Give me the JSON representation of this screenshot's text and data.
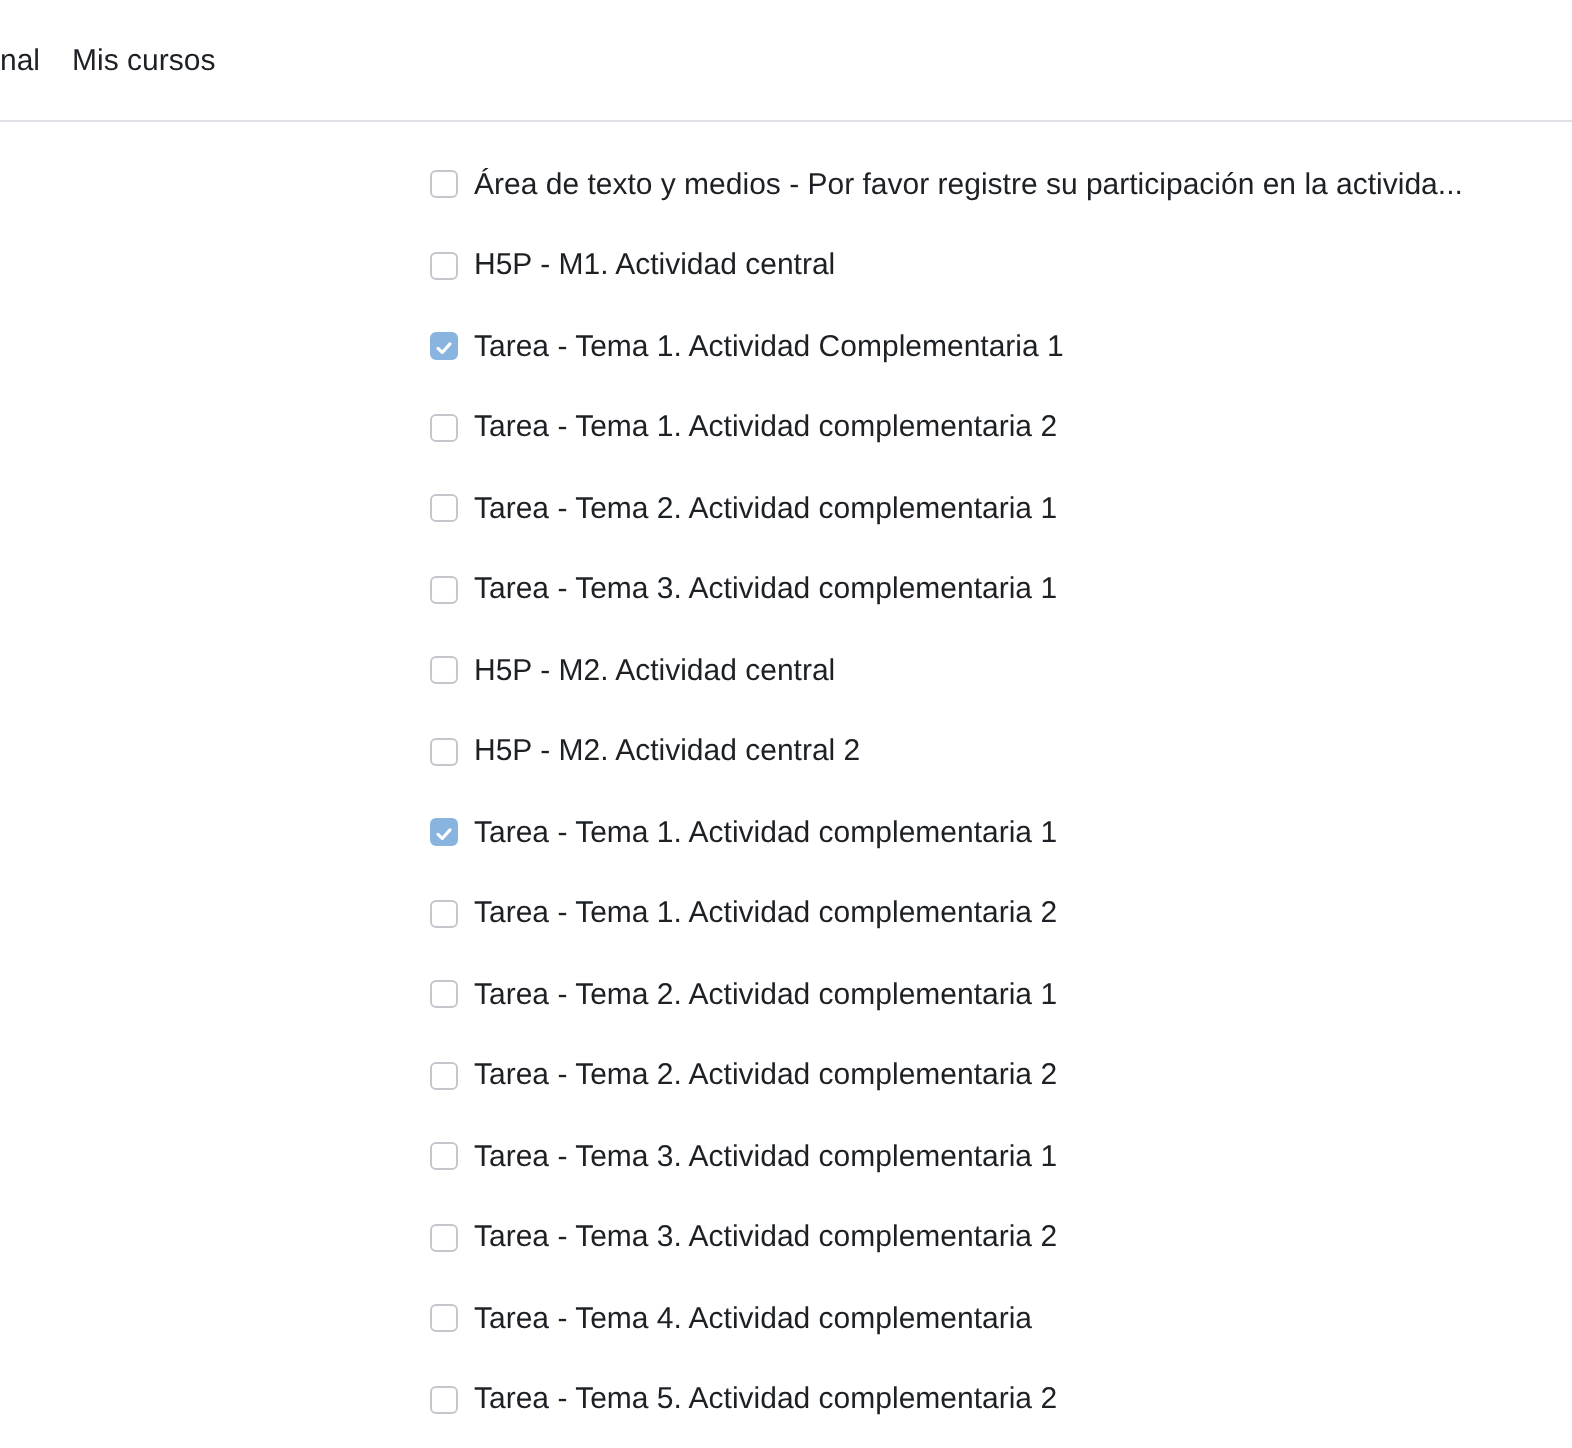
{
  "nav": {
    "links": [
      "nal",
      "Mis cursos"
    ]
  },
  "activities": [
    {
      "label": "Área de texto y medios - Por favor registre su participación en la activida...",
      "checked": false
    },
    {
      "label": "H5P - M1. Actividad central",
      "checked": false
    },
    {
      "label": "Tarea - Tema 1. Actividad Complementaria 1",
      "checked": true
    },
    {
      "label": "Tarea - Tema 1. Actividad complementaria 2",
      "checked": false
    },
    {
      "label": "Tarea - Tema 2. Actividad complementaria 1",
      "checked": false
    },
    {
      "label": "Tarea - Tema 3. Actividad complementaria 1",
      "checked": false
    },
    {
      "label": "H5P - M2. Actividad central",
      "checked": false
    },
    {
      "label": "H5P - M2. Actividad central 2",
      "checked": false
    },
    {
      "label": "Tarea - Tema 1. Actividad complementaria 1",
      "checked": true
    },
    {
      "label": "Tarea - Tema 1. Actividad complementaria 2",
      "checked": false
    },
    {
      "label": "Tarea - Tema 2. Actividad complementaria 1",
      "checked": false
    },
    {
      "label": "Tarea - Tema 2. Actividad complementaria 2",
      "checked": false
    },
    {
      "label": "Tarea - Tema 3. Actividad complementaria 1",
      "checked": false
    },
    {
      "label": "Tarea - Tema 3. Actividad complementaria 2",
      "checked": false
    },
    {
      "label": "Tarea - Tema 4. Actividad complementaria",
      "checked": false
    },
    {
      "label": "Tarea - Tema 5. Actividad complementaria 2",
      "checked": false
    }
  ]
}
